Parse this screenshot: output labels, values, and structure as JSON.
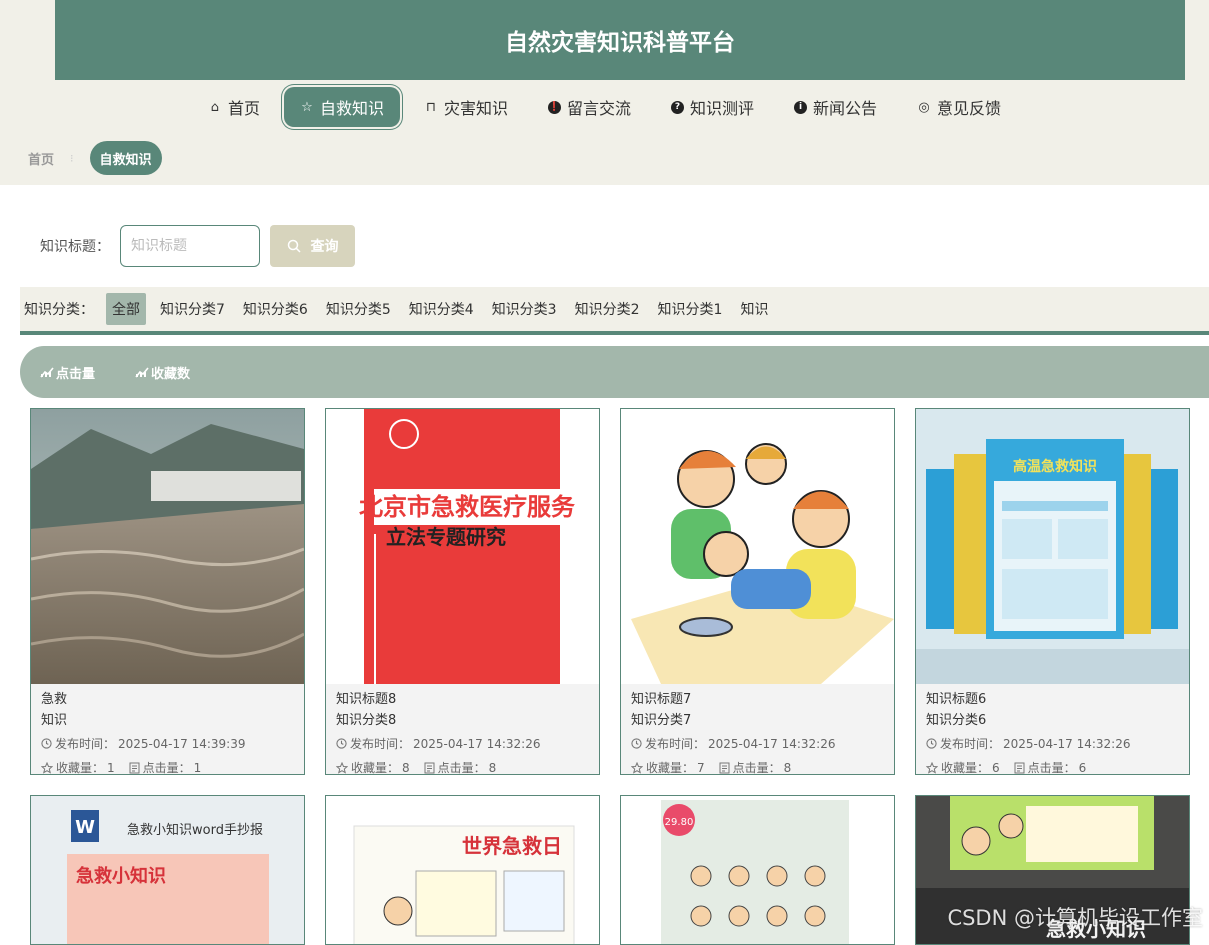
{
  "app": {
    "title": "自然灾害知识科普平台"
  },
  "nav": {
    "items": [
      {
        "label": "首页",
        "icon": "home-icon",
        "glyph": "⌂",
        "active": false
      },
      {
        "label": "自救知识",
        "icon": "star-icon",
        "glyph": "☆",
        "active": true
      },
      {
        "label": "灾害知识",
        "icon": "bag-icon",
        "glyph": "⊓",
        "active": false
      },
      {
        "label": "留言交流",
        "icon": "alert-icon",
        "glyph": "❗",
        "active": false
      },
      {
        "label": "知识测评",
        "icon": "question-icon",
        "glyph": "?",
        "active": false
      },
      {
        "label": "新闻公告",
        "icon": "info-icon",
        "glyph": "i",
        "active": false
      },
      {
        "label": "意见反馈",
        "icon": "feedback-icon",
        "glyph": "◎",
        "active": false
      }
    ]
  },
  "breadcrumb": {
    "home": "首页",
    "separator": "⁝",
    "current": "自救知识"
  },
  "search": {
    "label": "知识标题：",
    "placeholder": "知识标题",
    "button": "查询"
  },
  "categories": {
    "label": "知识分类：",
    "items": [
      "全部",
      "知识分类7",
      "知识分类6",
      "知识分类5",
      "知识分类4",
      "知识分类3",
      "知识分类2",
      "知识分类1",
      "知识"
    ],
    "active": "全部"
  },
  "sort": {
    "clicks": "点击量",
    "favorites": "收藏数"
  },
  "cards": [
    {
      "title": "急救",
      "category": "知识",
      "time_label": "发布时间：",
      "time": "2025-04-17 14:39:39",
      "fav_label": "收藏量：",
      "fav": "1",
      "click_label": "点击量：",
      "click": "1",
      "image": "flood-river-photo"
    },
    {
      "title": "知识标题8",
      "category": "知识分类8",
      "time_label": "发布时间：",
      "time": "2025-04-17 14:32:26",
      "fav_label": "收藏量：",
      "fav": "8",
      "click_label": "点击量：",
      "click": "8",
      "image": "red-book-cover",
      "book_title": "北京市急救医疗服务",
      "book_subtitle": "立法专题研究"
    },
    {
      "title": "知识标题7",
      "category": "知识分类7",
      "time_label": "发布时间：",
      "time": "2025-04-17 14:32:26",
      "fav_label": "收藏量：",
      "fav": "7",
      "click_label": "点击量：",
      "click": "8",
      "image": "first-aid-cartoon"
    },
    {
      "title": "知识标题6",
      "category": "知识分类6",
      "time_label": "发布时间：",
      "time": "2025-04-17 14:32:26",
      "fav_label": "收藏量：",
      "fav": "6",
      "click_label": "点击量：",
      "click": "6",
      "image": "poster-collage",
      "poster_title": "高温急救知识"
    }
  ],
  "cards_row2": [
    {
      "image": "word-handout",
      "text": "急救小知识word手抄报",
      "sub": "急救小知识"
    },
    {
      "image": "world-first-aid-day",
      "text": "世界急救日"
    },
    {
      "image": "book-illustrations",
      "text": "29.80"
    },
    {
      "image": "kids-cartoon-poster",
      "text": "急救小知识"
    }
  ],
  "watermark": "CSDN @计算机毕设工作室",
  "colors": {
    "primary": "#598779",
    "light": "#a3b7ab",
    "beige": "#f1f0e8",
    "button": "#d7d4bd"
  }
}
